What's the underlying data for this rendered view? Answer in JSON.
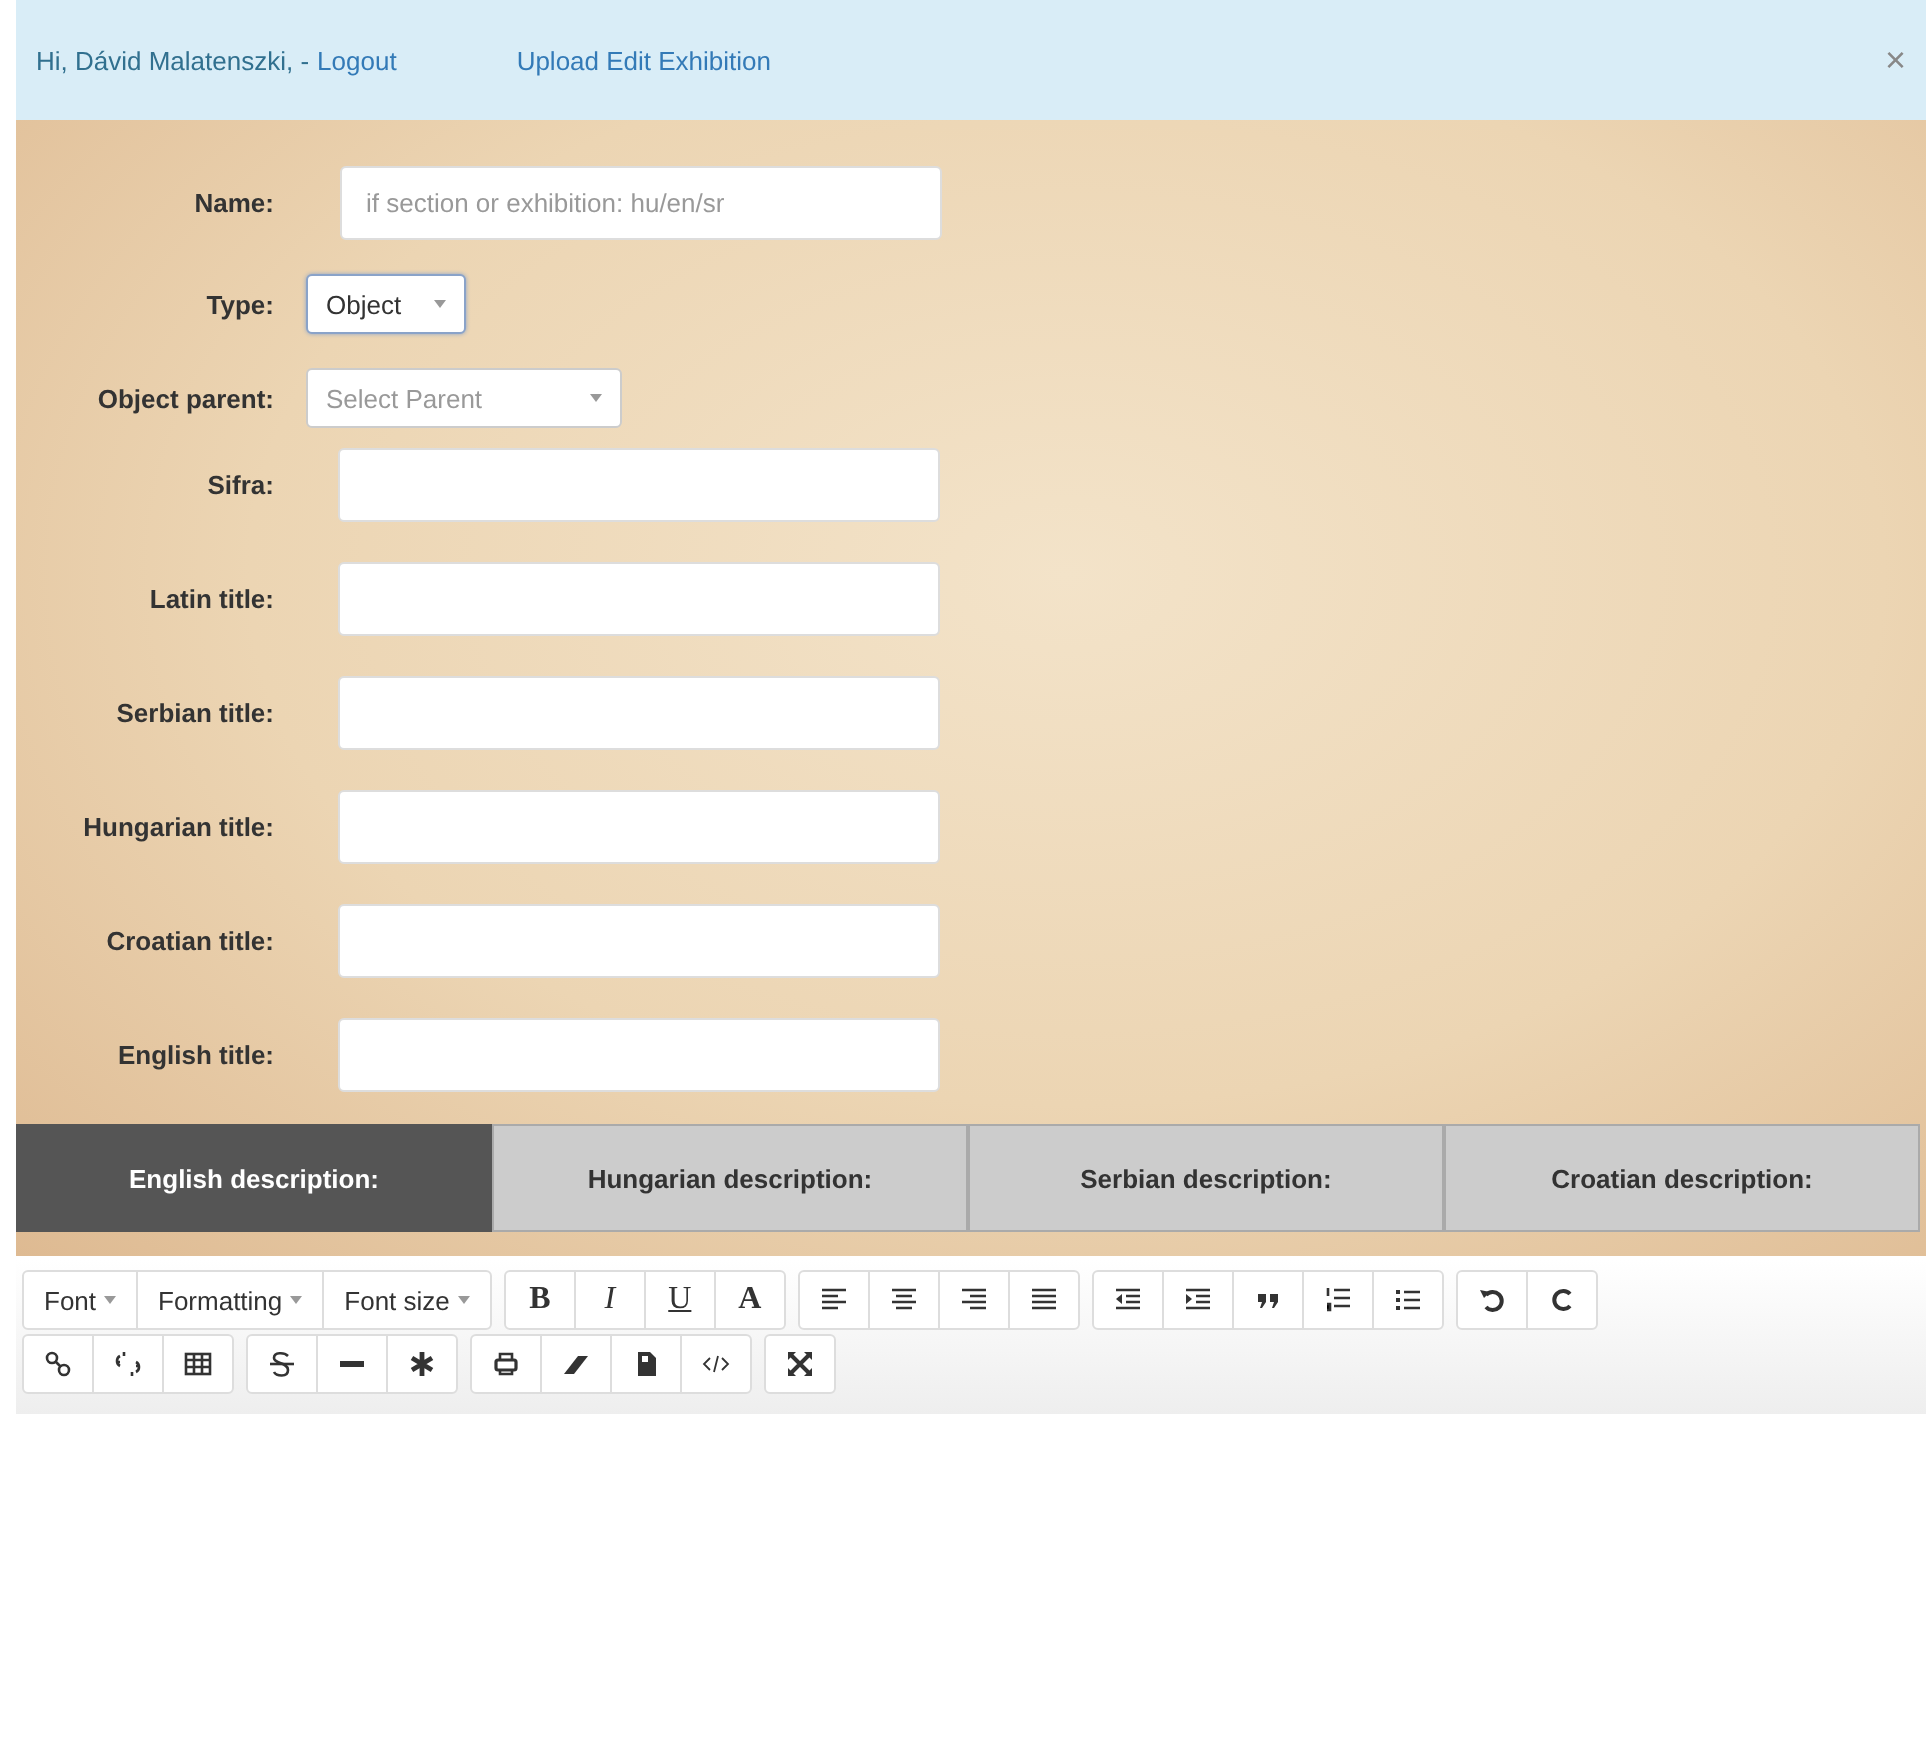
{
  "top_bar": {
    "greeting": "Hi, Dávid Malatenszki, -",
    "logout": "Logout",
    "nav_link": "Upload Edit Exhibition",
    "close": "×"
  },
  "form": {
    "name": {
      "label": "Name:",
      "placeholder": "if section or exhibition: hu/en/sr"
    },
    "type": {
      "label": "Type:",
      "value": "Object"
    },
    "parent": {
      "label": "Object parent:",
      "value": "Select Parent"
    },
    "fields": [
      {
        "label": "Sifra:"
      },
      {
        "label": "Latin title:"
      },
      {
        "label": "Serbian title:"
      },
      {
        "label": "Hungarian title:"
      },
      {
        "label": "Croatian title:"
      },
      {
        "label": "English title:"
      }
    ]
  },
  "tabs": [
    {
      "label": "English description:",
      "selected": true
    },
    {
      "label": "Hungarian description:",
      "selected": false
    },
    {
      "label": "Serbian description:",
      "selected": false
    },
    {
      "label": "Croatian description:",
      "selected": false
    }
  ],
  "editor": {
    "dropdowns": [
      "Font",
      "Formatting",
      "Font size"
    ],
    "format_buttons": [
      "B",
      "I",
      "U",
      "A"
    ]
  }
}
